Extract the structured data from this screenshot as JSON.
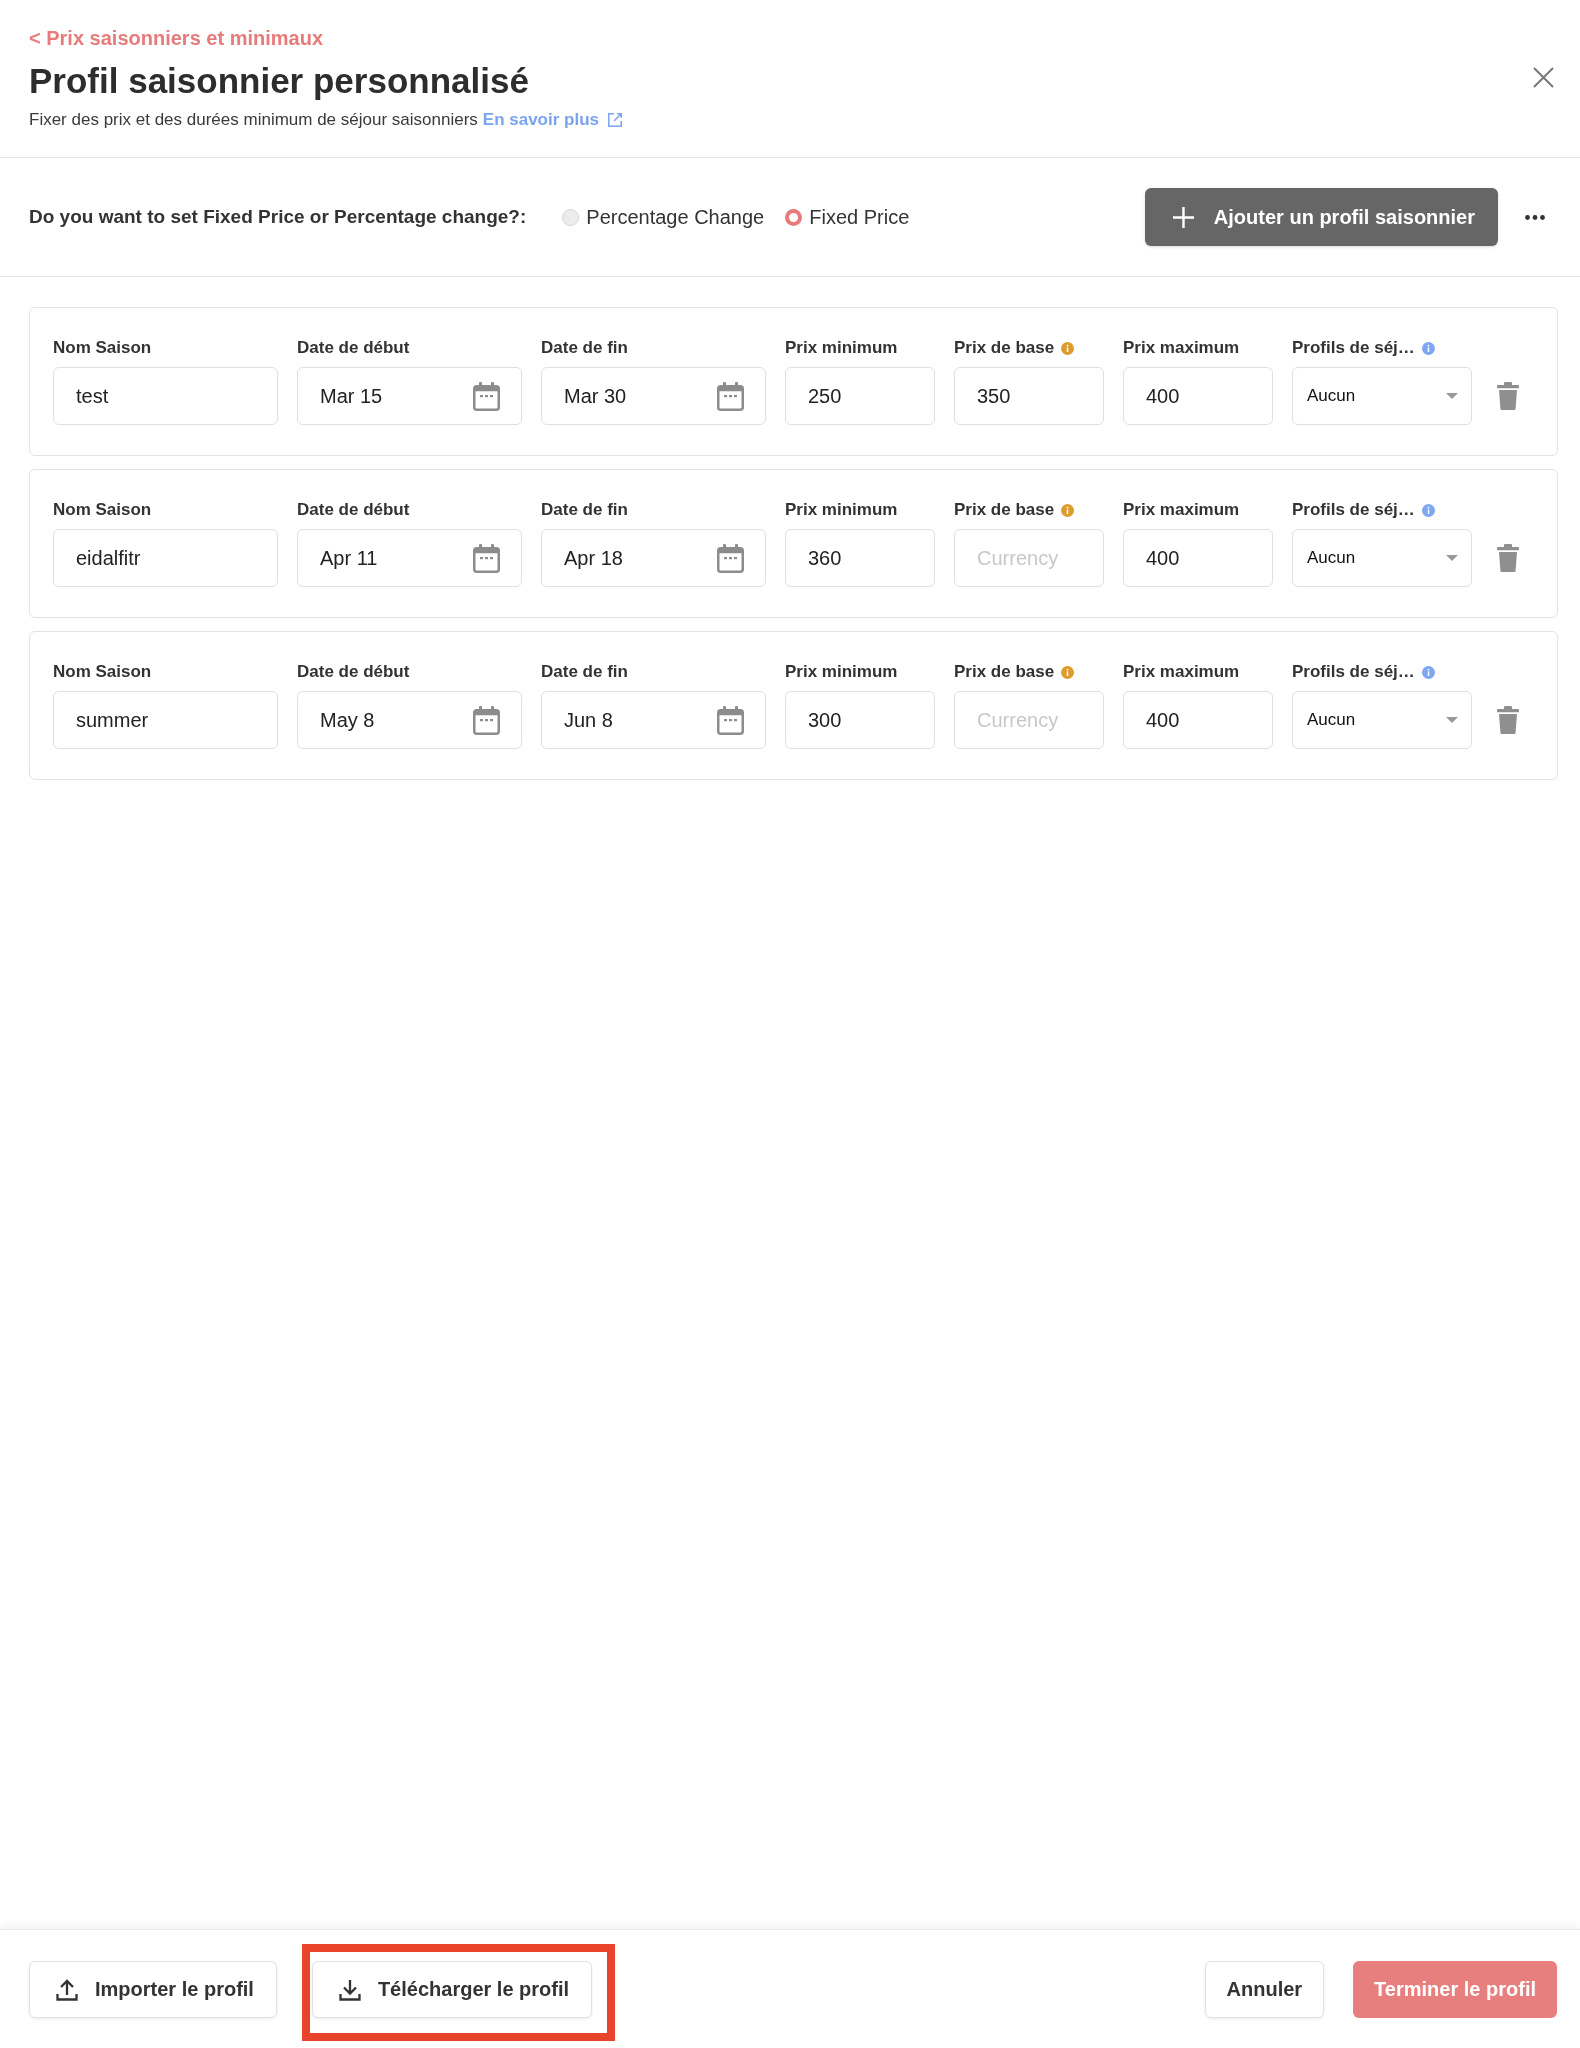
{
  "header": {
    "back_link": "< Prix saisonniers et minimaux",
    "title": "Profil saisonnier personnalisé",
    "subtitle": "Fixer des prix et des durées minimum de séjour saisonniers",
    "learn_more_link": "En savoir plus"
  },
  "mode_question": {
    "label": "Do you want to set Fixed Price or Percentage change?:",
    "options": [
      {
        "label": "Percentage Change",
        "selected": false
      },
      {
        "label": "Fixed Price",
        "selected": true
      }
    ]
  },
  "add_button": "Ajouter un profil saisonnier",
  "seasons": [
    {
      "fields": [
        {
          "label": "Nom Saison",
          "kind": "text",
          "value": "test"
        },
        {
          "label": "Date de début",
          "kind": "date",
          "value": "Mar 15"
        },
        {
          "label": "Date de fin",
          "kind": "date",
          "value": "Mar 30"
        },
        {
          "label": "Prix minimum",
          "kind": "price",
          "value": "250"
        },
        {
          "label": "Prix de base",
          "kind": "price",
          "info_icon": {
            "color": "#dc9d2c"
          },
          "value": "350"
        },
        {
          "label": "Prix maximum",
          "kind": "price",
          "value": "400"
        },
        {
          "label": "Profils de séj…",
          "kind": "select",
          "info_icon": {
            "color": "#7fa6f2"
          },
          "value": "Aucun"
        }
      ]
    },
    {
      "fields": [
        {
          "label": "Nom Saison",
          "kind": "text",
          "value": "eidalfitr"
        },
        {
          "label": "Date de début",
          "kind": "date",
          "value": "Apr 11"
        },
        {
          "label": "Date de fin",
          "kind": "date",
          "value": "Apr 18"
        },
        {
          "label": "Prix minimum",
          "kind": "price",
          "value": "360"
        },
        {
          "label": "Prix de base",
          "kind": "price",
          "info_icon": {
            "color": "#dc9d2c"
          },
          "placeholder": "Currency"
        },
        {
          "label": "Prix maximum",
          "kind": "price",
          "value": "400"
        },
        {
          "label": "Profils de séj…",
          "kind": "select",
          "info_icon": {
            "color": "#7fa6f2"
          },
          "value": "Aucun"
        }
      ]
    },
    {
      "fields": [
        {
          "label": "Nom Saison",
          "kind": "text",
          "value": "summer"
        },
        {
          "label": "Date de début",
          "kind": "date",
          "value": "May 8"
        },
        {
          "label": "Date de fin",
          "kind": "date",
          "value": "Jun 8"
        },
        {
          "label": "Prix minimum",
          "kind": "price",
          "value": "300"
        },
        {
          "label": "Prix de base",
          "kind": "price",
          "info_icon": {
            "color": "#dc9d2c"
          },
          "placeholder": "Currency"
        },
        {
          "label": "Prix maximum",
          "kind": "price",
          "value": "400"
        },
        {
          "label": "Profils de séj…",
          "kind": "select",
          "info_icon": {
            "color": "#7fa6f2"
          },
          "value": "Aucun"
        }
      ]
    }
  ],
  "footer": {
    "left_buttons": [
      {
        "label": "Importer le profil",
        "kind": "import",
        "highlighted": false
      },
      {
        "label": "Télécharger le profil",
        "kind": "download",
        "highlighted": true
      }
    ],
    "right_buttons": [
      {
        "label": "Annuler",
        "kind": "cancel"
      },
      {
        "label": "Terminer le profil",
        "kind": "confirm"
      }
    ]
  }
}
